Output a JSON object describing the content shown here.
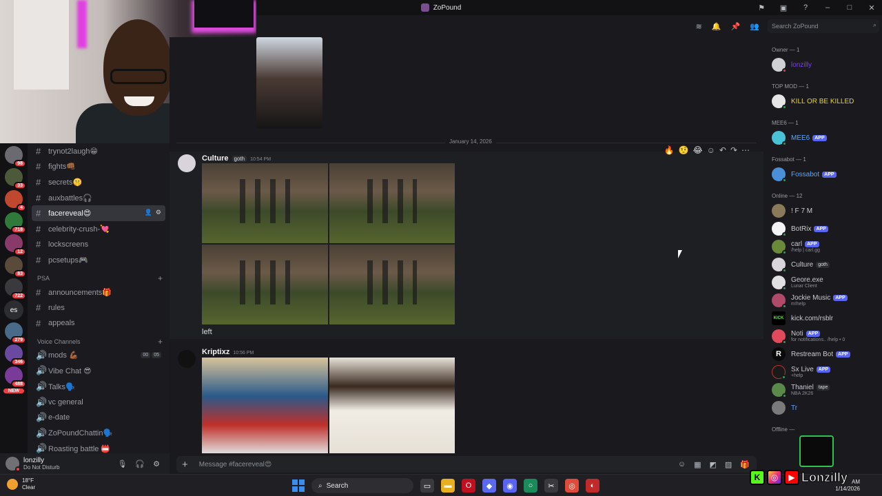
{
  "window": {
    "title": "ZoPound"
  },
  "search": {
    "placeholder": "Search ZoPound"
  },
  "server_rail": {
    "badges": [
      "98",
      "33",
      "4",
      "718",
      "12",
      "83",
      "722",
      "279",
      "346",
      "488"
    ],
    "text_server": "es",
    "new_label": "NEW"
  },
  "channels": {
    "top": [
      {
        "label": "trynot2laugh😁"
      },
      {
        "label": "fights👊🏾"
      },
      {
        "label": "secrets🤫"
      },
      {
        "label": "auxbattles🎧"
      },
      {
        "label": "facereveal😍"
      },
      {
        "label": "celebrity-crush-💘"
      },
      {
        "label": "lockscreens"
      },
      {
        "label": "pcsetups🎮"
      }
    ],
    "psa_category": "PSA",
    "psa": [
      {
        "label": "announcements🎁"
      },
      {
        "label": "rules"
      },
      {
        "label": "appeals"
      }
    ],
    "voice_category": "Voice Channels",
    "voice": [
      {
        "label": "mods 💪🏾",
        "a": "00",
        "b": "05"
      },
      {
        "label": "Vibe Chat 😎"
      },
      {
        "label": "Talks🗣️"
      },
      {
        "label": "vc general"
      },
      {
        "label": "e-date"
      },
      {
        "label": "ZoPoundChattin🗣️"
      },
      {
        "label": "Roasting battle 📛"
      }
    ]
  },
  "user": {
    "name": "lonzilly",
    "status": "Do Not Disturb"
  },
  "chat": {
    "date_divider": "January 14, 2026",
    "messages": [
      {
        "author": "Culture",
        "tag": "goth",
        "time": "10:54 PM",
        "text": "left"
      },
      {
        "author": "Kriptixz",
        "time": "10:56 PM"
      }
    ],
    "hover_reactions": [
      "🔥",
      "🤨",
      "😂"
    ],
    "composer_placeholder": "Message #facereveal😍"
  },
  "members": {
    "groups": [
      {
        "label": "Owner — 1",
        "items": [
          {
            "name": "lonzilly",
            "color": "#7b3fe4"
          }
        ]
      },
      {
        "label": "TOP MOD — 1",
        "items": [
          {
            "name": "KILL OR BE KILLED",
            "color": "#e6d23a"
          }
        ]
      },
      {
        "label": "MEE6 — 1",
        "items": [
          {
            "name": "MEE6",
            "color": "#5aa8ff",
            "app": "APP"
          }
        ]
      },
      {
        "label": "Fossabot — 1",
        "items": [
          {
            "name": "Fossabot",
            "color": "#5aa8ff",
            "app": "APP"
          }
        ]
      },
      {
        "label": "Online — 12",
        "items": [
          {
            "name": "! F 7 M"
          },
          {
            "name": "BotRix",
            "app": "APP"
          },
          {
            "name": "carl",
            "app": "APP",
            "sub": "/help | carl.gg"
          },
          {
            "name": "Culture",
            "tag": "goth"
          },
          {
            "name": "Geore.exe",
            "sub": "Lunar Client"
          },
          {
            "name": "Jockie Music",
            "app": "APP",
            "sub": "m!help"
          },
          {
            "name": "kick.com/rsblr"
          },
          {
            "name": "Noti",
            "app": "APP",
            "sub": "for notifications.. /help • 0"
          },
          {
            "name": "Restream Bot",
            "app": "APP"
          },
          {
            "name": "Sx Live",
            "app": "APP",
            "sub": "+help"
          },
          {
            "name": "Thaniel",
            "tag": "tape",
            "sub": "NBA 2K26"
          },
          {
            "name": "Tr"
          }
        ]
      }
    ],
    "offline_label": "Offline —"
  },
  "taskbar": {
    "weather_temp": "18°F",
    "weather_cond": "Clear",
    "search_label": "Search",
    "clock_time": "AM",
    "clock_date": "1/14/2026"
  },
  "brand": {
    "name": "Lonzilly"
  },
  "colors": {
    "accent": "#5865f2",
    "bg": "#1a1a1e",
    "online": "#23a55a",
    "dnd": "#f23f43"
  }
}
